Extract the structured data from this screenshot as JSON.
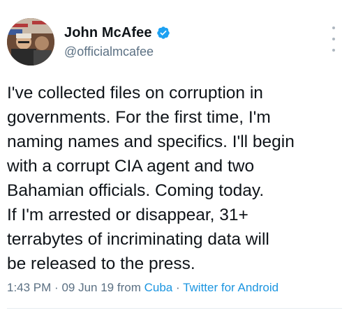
{
  "author": {
    "display_name": "John McAfee",
    "handle": "@officialmcafee",
    "verified": true
  },
  "tweet": {
    "lines": [
      "I've collected files on corruption in",
      "governments. For the first time, I'm",
      "naming names and specifics. I'll begin",
      "with a corrupt CIA agent and two",
      "Bahamian officials. Coming today.",
      "If I'm arrested or disappear, 31+",
      "terrabytes of incriminating data will",
      "be released to the press."
    ]
  },
  "meta": {
    "time": "1:43 PM",
    "separator": "·",
    "date": "09 Jun 19",
    "from_label": "from",
    "location": "Cuba",
    "client": "Twitter for Android"
  },
  "icons": {
    "verified": "verified-badge-icon",
    "more": "more-vertical-icon"
  },
  "colors": {
    "text_primary": "#0f1419",
    "text_secondary": "#5b7083",
    "link": "#1b95e0",
    "verified": "#1da1f2"
  }
}
